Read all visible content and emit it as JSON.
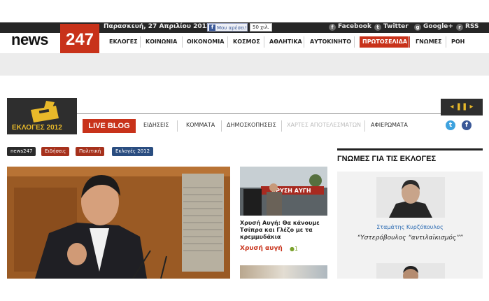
{
  "topbar": {
    "date": "Παρασκευή, 27 Απριλίου 2012",
    "fb_like_label": "Μου αρέσει!",
    "fb_like_count": "50 χιλ.",
    "social": [
      {
        "icon": "facebook-icon",
        "glyph": "f",
        "label": "Facebook"
      },
      {
        "icon": "twitter-icon",
        "glyph": "t",
        "label": "Twitter"
      },
      {
        "icon": "google-plus-icon",
        "glyph": "g",
        "label": "Google+"
      },
      {
        "icon": "rss-icon",
        "glyph": "r",
        "label": "RSS"
      }
    ]
  },
  "logo": {
    "word": "news",
    "number": "247"
  },
  "nav": [
    "ΕΚΛΟΓΕΣ",
    "ΚΟΙΝΩΝΙΑ",
    "ΟΙΚΟΝΟΜΙΑ",
    "ΚΟΣΜΟΣ",
    "ΑΘΛΗΤΙΚΑ",
    "ΑΥΤΟΚΙΝΗΤΟ",
    "ΠΡΩΤΟΣΕΛΙΔΑ",
    "ΓΝΩΜΕΣ",
    "ΡΟΗ"
  ],
  "elections": {
    "logo_text": "ΕΚΛΟΓΕΣ 2012",
    "live_blog": "LIVE BLOG",
    "subnav": [
      "ΕΙΔΗΣΕΙΣ",
      "ΚΟΜΜΑΤΑ",
      "ΔΗΜΟΣΚΟΠΗΣΕΙΣ",
      "ΧΑΡΤΕΣ ΑΠΟΤΕΛΕΣΜΑΤΩΝ",
      "ΑΦΙΕΡΩΜΑΤΑ"
    ],
    "arrows": "◂ ❚❚ ▸"
  },
  "tags": [
    "news247",
    "Ειδήσεις",
    "Πολιτική",
    "Εκλογές 2012"
  ],
  "colors": {
    "brand_red": "#c8321a",
    "dark": "#2e2e2e",
    "gold": "#e8b92a",
    "link_blue": "#2a6ab2"
  },
  "story": {
    "banner": "ΧΡΥΣΗ ΑΥΓΗ",
    "caption": "Χρυσή Αυγή: Θα κάνουμε Τσίπρα και Γλέζο με τα κρεμμυδάκια",
    "category": "Χρυσή αυγή",
    "comments": "1"
  },
  "opinions": {
    "title": "ΓΝΩΜΕΣ ΓΙΑ ΤΙΣ ΕΚΛΟΓΕΣ",
    "author": "Σταμάτης Κυρζόπουλος",
    "quote": "“Υστερόβουλος “αντιλαϊκισμός””"
  }
}
